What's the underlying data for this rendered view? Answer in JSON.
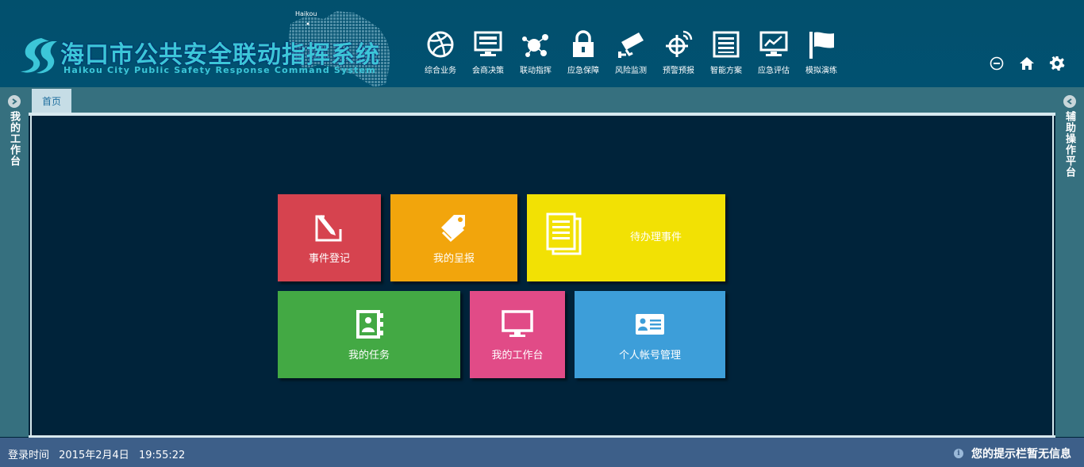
{
  "app": {
    "title": "海口市公共安全联动指挥系统",
    "subtitle": "Haikou City Public Safety Response Command System",
    "map_label": "Haikou"
  },
  "nav": [
    {
      "label": "综合业务",
      "icon": "basketball-icon"
    },
    {
      "label": "会商决策",
      "icon": "monitor-icon"
    },
    {
      "label": "联动指挥",
      "icon": "network-icon"
    },
    {
      "label": "应急保障",
      "icon": "lock-icon"
    },
    {
      "label": "风险监测",
      "icon": "camera-icon"
    },
    {
      "label": "预警预报",
      "icon": "crosshair-icon"
    },
    {
      "label": "智能方案",
      "icon": "list-icon"
    },
    {
      "label": "应急评估",
      "icon": "chart-monitor-icon"
    },
    {
      "label": "模拟演练",
      "icon": "flag-icon"
    }
  ],
  "tools": [
    "minimize-icon",
    "home-icon",
    "gear-icon"
  ],
  "left_panel": {
    "title": "我的工作台"
  },
  "right_panel": {
    "title": "辅助操作平台"
  },
  "tabs": [
    {
      "label": "首页"
    }
  ],
  "tiles": [
    {
      "label": "事件登记",
      "color": "#d6434f",
      "icon": "edit-icon"
    },
    {
      "label": "我的呈报",
      "color": "#f2a50c",
      "icon": "tags-icon"
    },
    {
      "label": "待办理事件",
      "color": "#f2e104",
      "icon": "documents-icon"
    },
    {
      "label": "我的任务",
      "color": "#43a944",
      "icon": "contact-book-icon"
    },
    {
      "label": "我的工作台",
      "color": "#e14b87",
      "icon": "desktop-icon"
    },
    {
      "label": "个人帐号管理",
      "color": "#3d9ed9",
      "icon": "id-card-icon"
    }
  ],
  "footer": {
    "login_label": "登录时间",
    "login_date": "2015年2月4日",
    "login_time": "19:55:22",
    "hint": "您的提示栏暂无信息"
  }
}
